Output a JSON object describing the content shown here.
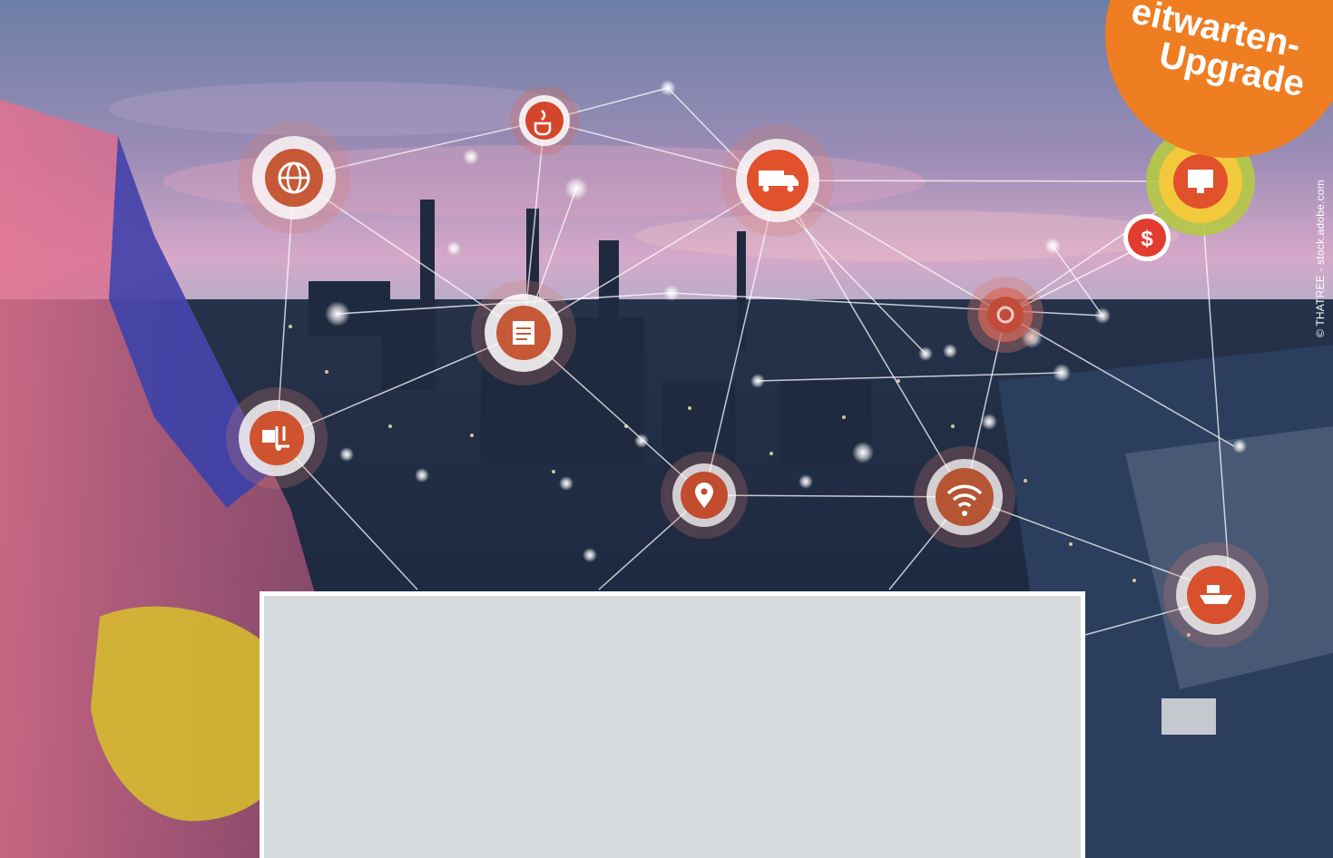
{
  "badge": {
    "line1": "eitwarten-",
    "line2": "Upgrade"
  },
  "credit": "© THATREE - stock.adobe.com",
  "colors": {
    "badge": "#ef7d22",
    "node": "#c65a38",
    "link": "#ffffff"
  },
  "icons": [
    "java-icon",
    "globe-icon",
    "truck-icon",
    "monitor-icon",
    "dollar-icon",
    "document-icon",
    "gear-icon",
    "forklift-icon",
    "location-pin-icon",
    "wifi-icon",
    "ship-icon"
  ]
}
